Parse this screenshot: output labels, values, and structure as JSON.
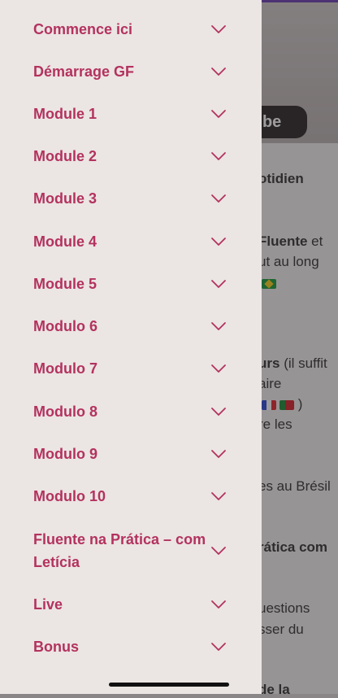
{
  "background": {
    "video_badge": "Tube",
    "texts": [
      {
        "text": "otidien",
        "bold": true
      },
      {
        "text": "Fluente",
        "bold": true,
        "suffix": " et"
      },
      {
        "text": "ut au long"
      },
      {
        "text": "urs",
        "bold": true,
        "suffix": " (il suffit"
      },
      {
        "text": "aire"
      },
      {
        "text": "re les"
      },
      {
        "text": "es au Brésil"
      },
      {
        "text": "rática com",
        "bold": true
      },
      {
        "text": "uestions"
      },
      {
        "text": "sser du"
      },
      {
        "text": "de la",
        "bold": true
      }
    ]
  },
  "menu": {
    "items": [
      {
        "label": "Commence ici"
      },
      {
        "label": "Démarrage GF"
      },
      {
        "label": "Module 1"
      },
      {
        "label": "Module 2"
      },
      {
        "label": "Module 3"
      },
      {
        "label": "Module 4"
      },
      {
        "label": "Module 5"
      },
      {
        "label": "Modulo 6"
      },
      {
        "label": "Modulo 7"
      },
      {
        "label": "Modulo 8"
      },
      {
        "label": "Modulo 9"
      },
      {
        "label": "Modulo 10"
      },
      {
        "label": "Fluente na Prática – com Letícia"
      },
      {
        "label": "Live"
      },
      {
        "label": "Bonus"
      }
    ],
    "accent_color": "#b3325f",
    "expand_icon": "chevron-down-icon"
  }
}
